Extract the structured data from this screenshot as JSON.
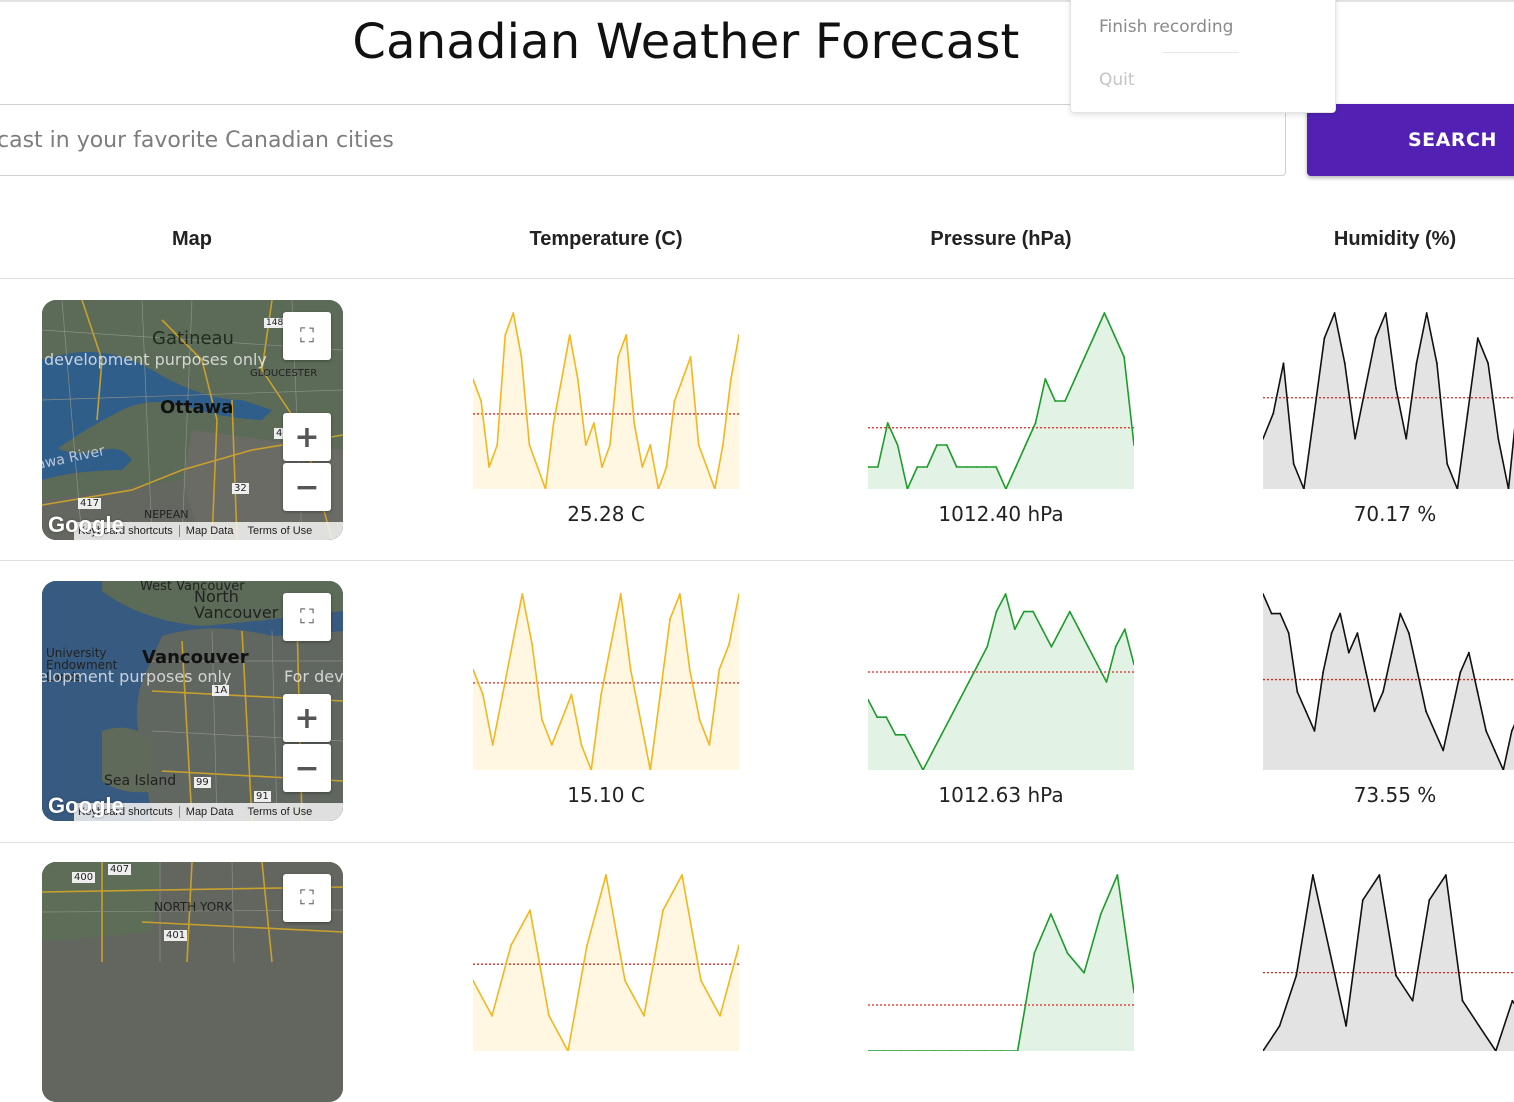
{
  "page": {
    "title": "Canadian Weather Forecast"
  },
  "menu": {
    "items": [
      "Finish recording",
      "Quit"
    ]
  },
  "search": {
    "placeholder": "cast in your favorite Canadian cities",
    "button_label": "SEARCH"
  },
  "table": {
    "headers": [
      "Map",
      "Temperature (C)",
      "Pressure (hPa)",
      "Humidity (%)"
    ],
    "rows": [
      {
        "map": {
          "labels": [
            "Gatineau",
            "Ottawa",
            "GLOUCESTER",
            "NEPEAN",
            "awa River"
          ],
          "shields": [
            "148",
            "417",
            "32",
            "4"
          ],
          "watermark": "development purposes only"
        },
        "values": [
          "25.28 C",
          "1012.40 hPa",
          "70.17 %"
        ]
      },
      {
        "map": {
          "labels": [
            "West Vancouver",
            "North Vancouver",
            "Vancouver",
            "University Endowment Lands",
            "Sea Island"
          ],
          "shields": [
            "1A",
            "99",
            "91"
          ],
          "watermark": "elopment purposes only",
          "watermark2": "For dev"
        },
        "values": [
          "15.10 C",
          "1012.63 hPa",
          "73.55 %"
        ]
      },
      {
        "map": {
          "labels": [
            "NORTH YORK"
          ],
          "shields": [
            "400",
            "407",
            "401"
          ]
        }
      }
    ]
  },
  "map_footer": {
    "logo": "Google",
    "shortcuts": "Keyboard shortcuts",
    "map_data": "Map Data",
    "terms": "Terms of Use"
  },
  "colors": {
    "temperature": "#f5b51c",
    "temperature_fill": "#fff7e2",
    "pressure": "#1e9c2a",
    "pressure_fill": "#e2f2e4",
    "humidity": "#111111",
    "humidity_fill": "#e3e3e3",
    "average_line": "#e0261c",
    "search_button": "#5221b3"
  },
  "chart_data": [
    {
      "type": "line",
      "name": "temperature-row-1",
      "values": [
        5,
        4,
        1,
        2,
        7,
        8,
        6,
        2,
        1,
        0,
        3,
        5,
        7,
        5,
        2,
        3,
        1,
        2,
        6,
        7,
        3,
        1,
        2,
        0,
        1,
        4,
        5,
        6,
        2,
        1,
        0,
        2,
        5,
        7
      ]
    },
    {
      "type": "area",
      "name": "pressure-row-1",
      "values": [
        4,
        4,
        6,
        5,
        3,
        4,
        4,
        5,
        5,
        4,
        4,
        4,
        4,
        4,
        3,
        4,
        5,
        6,
        8,
        7,
        7,
        8,
        9,
        10,
        11,
        10,
        9,
        5
      ]
    },
    {
      "type": "area",
      "name": "humidity-row-1",
      "values": [
        5,
        6,
        8,
        4,
        3,
        6,
        9,
        10,
        8,
        5,
        7,
        9,
        10,
        7,
        5,
        8,
        10,
        8,
        4,
        3,
        6,
        9,
        8,
        5,
        3,
        7,
        6
      ]
    },
    {
      "type": "line",
      "name": "temperature-row-2",
      "values": [
        5,
        4,
        2,
        4,
        6,
        8,
        6,
        3,
        2,
        3,
        4,
        2,
        1,
        4,
        6,
        8,
        5,
        3,
        1,
        4,
        7,
        8,
        5,
        3,
        2,
        5,
        6,
        8
      ]
    },
    {
      "type": "area",
      "name": "pressure-row-2",
      "values": [
        4,
        3,
        3,
        2,
        2,
        1,
        0,
        1,
        2,
        3,
        4,
        5,
        6,
        7,
        9,
        10,
        8,
        9,
        9,
        8,
        7,
        8,
        9,
        8,
        7,
        6,
        5,
        7,
        8,
        6
      ]
    },
    {
      "type": "area",
      "name": "humidity-row-2",
      "values": [
        9,
        8,
        8,
        7,
        4,
        3,
        2,
        5,
        7,
        8,
        6,
        7,
        5,
        3,
        4,
        6,
        8,
        7,
        5,
        3,
        2,
        1,
        3,
        5,
        6,
        4,
        2,
        1,
        0,
        2,
        3,
        4
      ]
    },
    {
      "type": "line",
      "name": "temperature-row-3",
      "values": [
        6,
        5,
        7,
        8,
        5,
        4,
        7,
        9,
        6,
        5,
        8,
        9,
        6,
        5,
        7
      ]
    },
    {
      "type": "area",
      "name": "pressure-row-3",
      "values": [
        0,
        0,
        0,
        0,
        0,
        0,
        0,
        0,
        0,
        0,
        5,
        7,
        5,
        4,
        7,
        9,
        3
      ]
    },
    {
      "type": "area",
      "name": "humidity-row-3",
      "values": [
        2,
        3,
        5,
        9,
        6,
        3,
        8,
        9,
        5,
        4,
        8,
        9,
        4,
        3,
        2,
        4,
        3
      ]
    }
  ]
}
